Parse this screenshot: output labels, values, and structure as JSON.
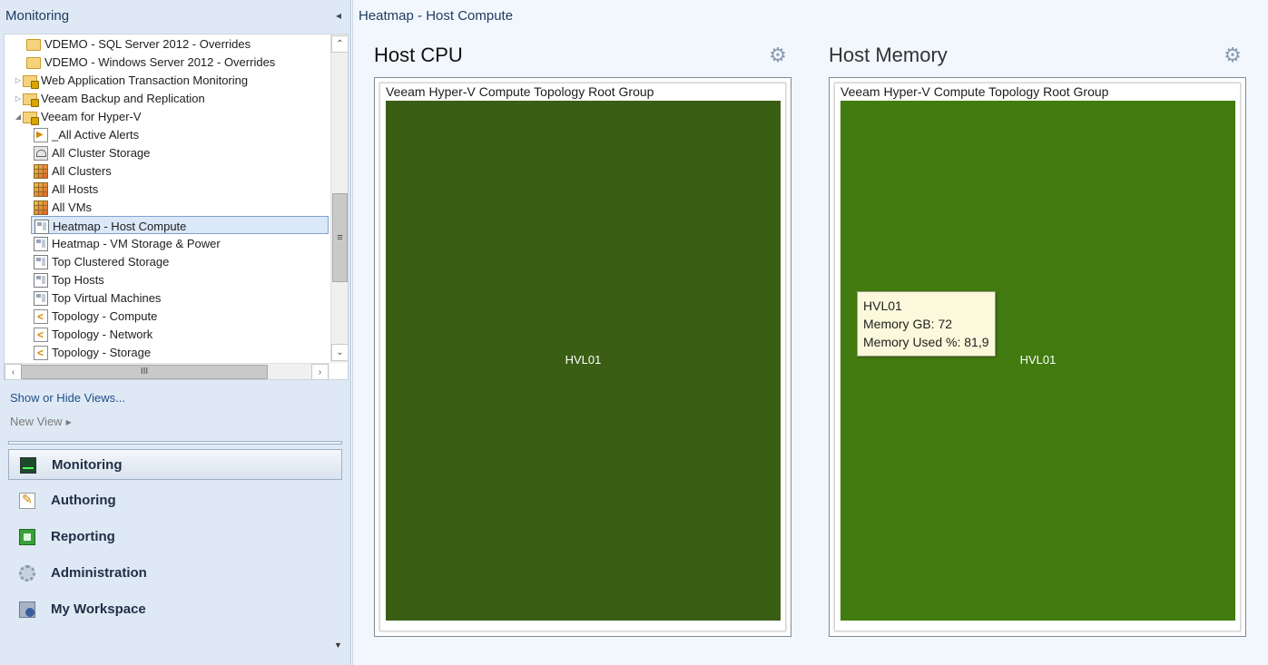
{
  "nav": {
    "title": "Monitoring",
    "collapse_glyph": "◂",
    "tree": [
      {
        "label": "VDEMO - SQL Server 2012 - Overrides",
        "icon": "folder-icon",
        "expander": ""
      },
      {
        "label": "VDEMO - Windows Server 2012 - Overrides",
        "icon": "folder-icon",
        "expander": ""
      },
      {
        "label": "Web Application Transaction Monitoring",
        "icon": "locked-folder-icon",
        "expander": "▷"
      },
      {
        "label": "Veeam Backup and Replication",
        "icon": "locked-folder-icon",
        "expander": "▷"
      },
      {
        "label": "Veeam for Hyper-V",
        "icon": "locked-folder-icon",
        "expander": "◢"
      },
      {
        "label": "_All Active Alerts",
        "icon": "alert-view-icon"
      },
      {
        "label": "All Cluster Storage",
        "icon": "storage-view-icon"
      },
      {
        "label": "All Clusters",
        "icon": "state-view-icon"
      },
      {
        "label": "All Hosts",
        "icon": "state-view-icon"
      },
      {
        "label": "All VMs",
        "icon": "state-view-icon"
      },
      {
        "label": "Heatmap - Host Compute",
        "icon": "dashboard-view-icon",
        "selected": true
      },
      {
        "label": "Heatmap - VM Storage & Power",
        "icon": "dashboard-view-icon"
      },
      {
        "label": "Top Clustered Storage",
        "icon": "dashboard-view-icon"
      },
      {
        "label": "Top Hosts",
        "icon": "dashboard-view-icon"
      },
      {
        "label": "Top Virtual Machines",
        "icon": "dashboard-view-icon"
      },
      {
        "label": "Topology - Compute",
        "icon": "diagram-view-icon"
      },
      {
        "label": "Topology - Network",
        "icon": "diagram-view-icon"
      },
      {
        "label": "Topology - Storage",
        "icon": "diagram-view-icon"
      }
    ],
    "scroll": {
      "up": "⌃",
      "down": "⌄",
      "left": "‹",
      "right": "›",
      "thumb_grip": "≡",
      "h_grip": "III"
    },
    "show_hide_label": "Show or Hide Views...",
    "new_view_label": "New View",
    "new_view_arrow": "▶",
    "workspaces": [
      {
        "label": "Monitoring",
        "icon": "monitoring-icon",
        "active": true
      },
      {
        "label": "Authoring",
        "icon": "authoring-icon"
      },
      {
        "label": "Reporting",
        "icon": "reporting-icon"
      },
      {
        "label": "Administration",
        "icon": "administration-icon"
      },
      {
        "label": "My Workspace",
        "icon": "my-workspace-icon"
      }
    ],
    "more_glyph": "▼"
  },
  "main": {
    "title": "Heatmap - Host Compute",
    "panels": [
      {
        "title": "Host CPU",
        "group": "Veeam Hyper-V Compute Topology Root Group",
        "tile_label": "HVL01",
        "tile_color": "#3a5e14",
        "gear": "⚙"
      },
      {
        "title": "Host Memory",
        "group": "Veeam Hyper-V Compute Topology Root Group",
        "tile_label": "HVL01",
        "tile_color": "#427b10",
        "gear": "⚙",
        "tooltip": {
          "name": "HVL01",
          "memory_gb": "Memory GB: 72",
          "memory_used": "Memory Used %: 81,9"
        }
      }
    ]
  }
}
